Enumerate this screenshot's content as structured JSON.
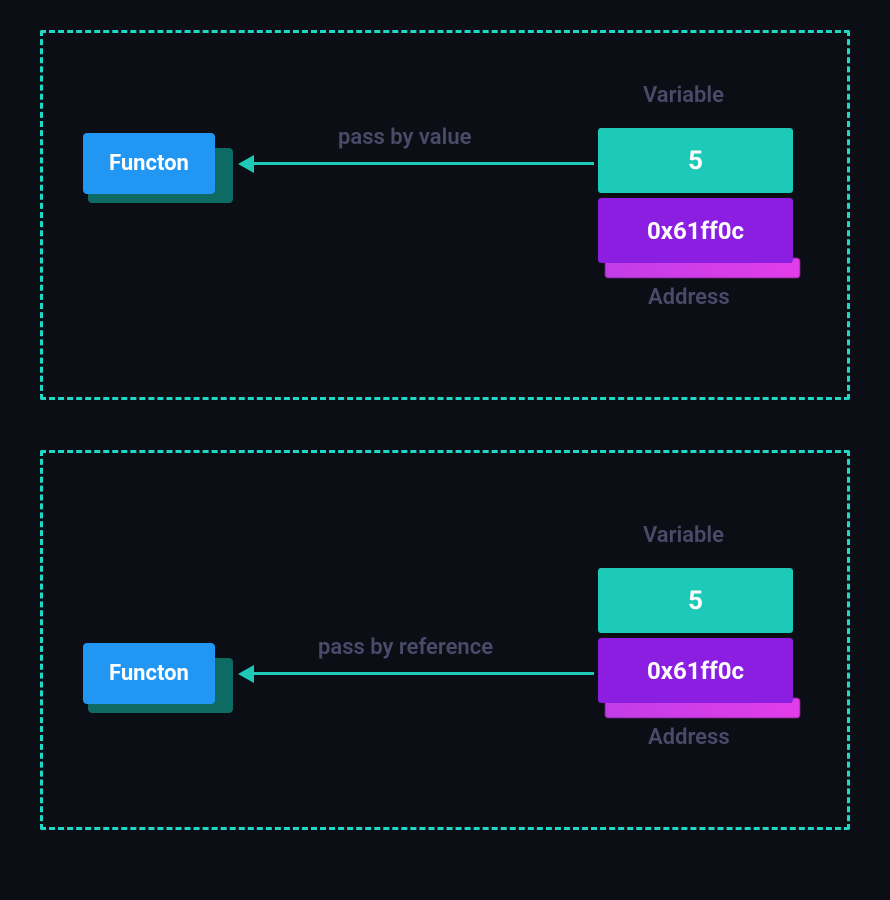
{
  "colors": {
    "border": "#20d8c7",
    "function": "#2196f3",
    "value": "#1dc9b7",
    "address": "#8b1ee0",
    "label": "#4a4a6a",
    "bg": "#0b0e14"
  },
  "top": {
    "function_label": "Functon",
    "arrow_label": "pass by value",
    "variable_label": "Variable",
    "value_text": "5",
    "address_text": "0x61ff0c",
    "address_label": "Address"
  },
  "bottom": {
    "function_label": "Functon",
    "arrow_label": "pass by reference",
    "variable_label": "Variable",
    "value_text": "5",
    "address_text": "0x61ff0c",
    "address_label": "Address"
  }
}
